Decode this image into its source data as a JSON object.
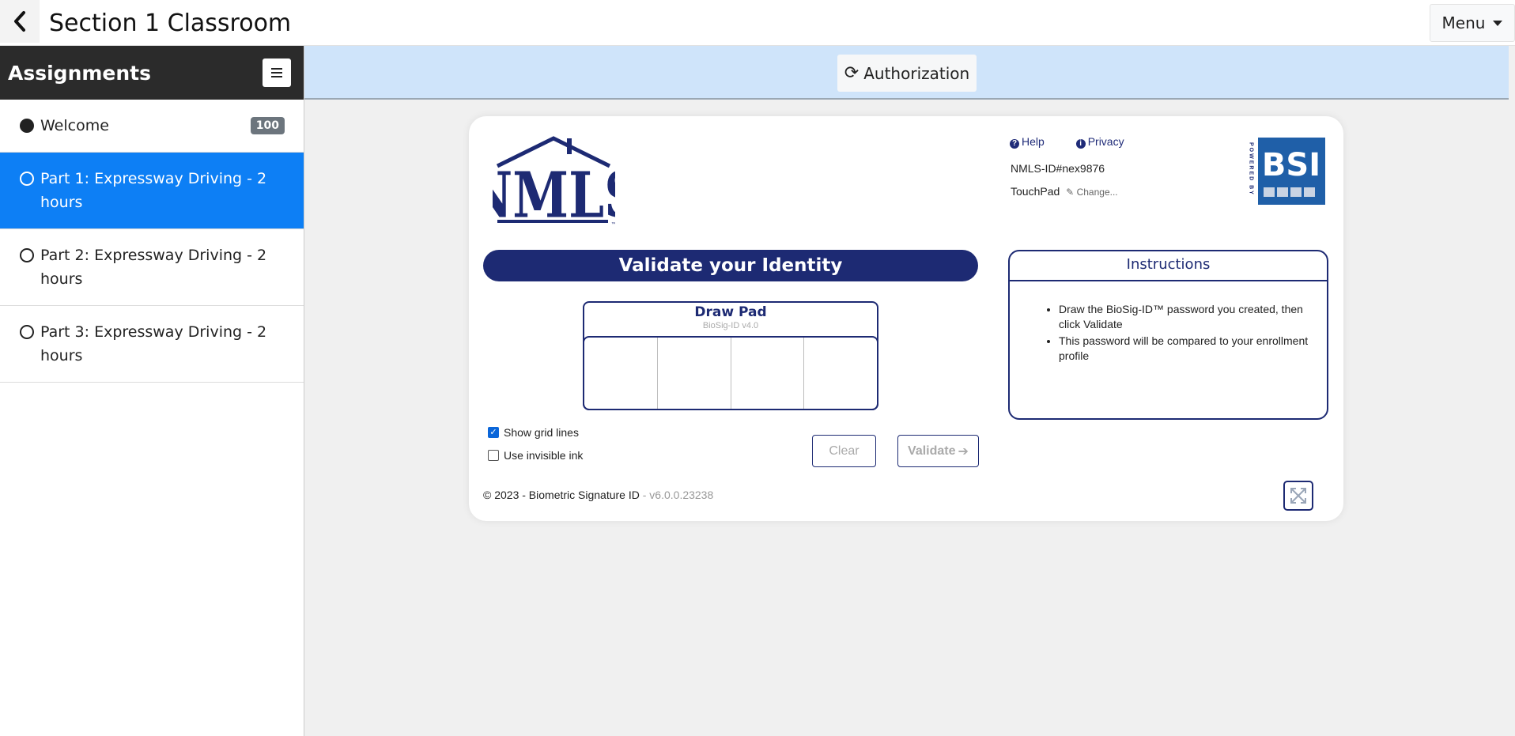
{
  "header": {
    "title": "Section 1 Classroom",
    "back_icon": "chevron-left-icon",
    "menu_label": "Menu"
  },
  "sidebar": {
    "title": "Assignments",
    "items": [
      {
        "label": "Welcome",
        "badge": "100",
        "status": "complete"
      },
      {
        "label": "Part 1: Expressway Driving - 2 hours",
        "status": "active"
      },
      {
        "label": "Part 2: Expressway Driving - 2 hours",
        "status": "incomplete"
      },
      {
        "label": "Part 3: Expressway Driving - 2 hours",
        "status": "incomplete"
      }
    ]
  },
  "authbar": {
    "button_label": "Authorization",
    "icon": "refresh-icon"
  },
  "card": {
    "logo_text": "NMLS",
    "logo_tm": "™",
    "help_label": "Help",
    "privacy_label": "Privacy",
    "nmls_id": "NMLS-ID#nex9876",
    "device": "TouchPad",
    "change_label": "Change...",
    "bsi_powered": "POWERED BY",
    "bsi_text": "BSI",
    "validate_title": "Validate your Identity",
    "drawpad_title": "Draw Pad",
    "drawpad_version": "BioSig-ID v4.0",
    "show_grid_label": "Show grid lines",
    "show_grid_checked": true,
    "invisible_ink_label": "Use invisible ink",
    "invisible_ink_checked": false,
    "clear_label": "Clear",
    "validate_label": "Validate",
    "instructions_title": "Instructions",
    "instructions": [
      "Draw the BioSig-ID™ password you created, then click Validate",
      "This password will be compared to your enrollment profile"
    ],
    "copyright": "© 2023 - Biometric Signature ID",
    "version": " - v6.0.0.23238"
  },
  "colors": {
    "navy": "#1d2a73",
    "active_blue": "#0d7ff5",
    "auth_bar": "#cfe4fa",
    "sidebar_header": "#2b2b2b"
  }
}
